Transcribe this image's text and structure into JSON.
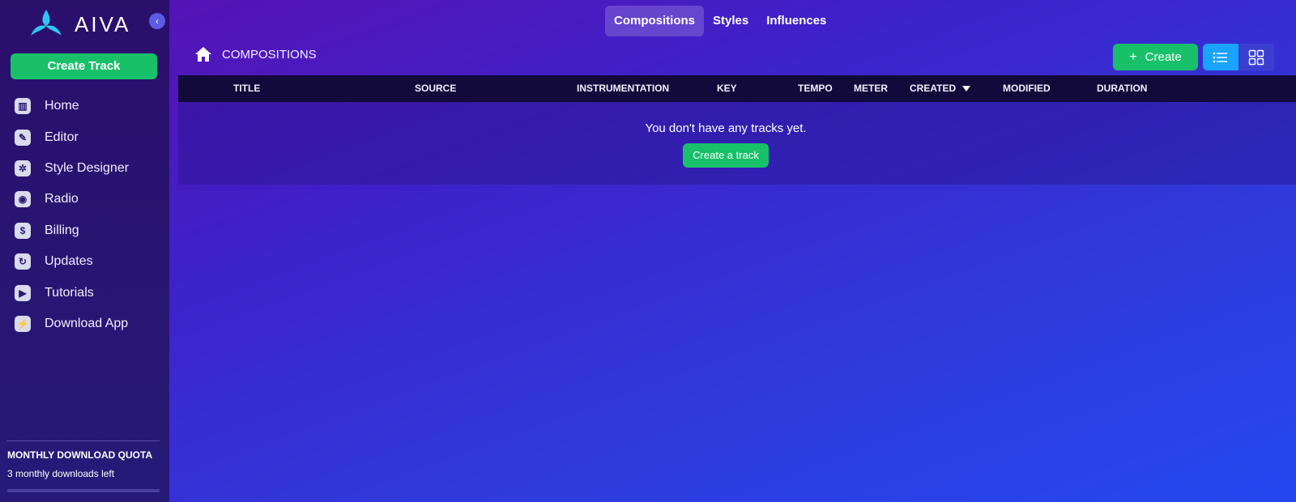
{
  "app": {
    "name": "AIVA"
  },
  "sidebar": {
    "create_track_label": "Create Track",
    "items": [
      {
        "label": "Home",
        "icon": "home-icon"
      },
      {
        "label": "Editor",
        "icon": "pencil-icon"
      },
      {
        "label": "Style Designer",
        "icon": "style-designer-icon"
      },
      {
        "label": "Radio",
        "icon": "radio-icon"
      },
      {
        "label": "Billing",
        "icon": "dollar-icon"
      },
      {
        "label": "Updates",
        "icon": "updates-icon"
      },
      {
        "label": "Tutorials",
        "icon": "play-icon"
      },
      {
        "label": "Download App",
        "icon": "download-icon"
      }
    ],
    "quota_title": "MONTHLY DOWNLOAD QUOTA",
    "quota_text": "3 monthly downloads left"
  },
  "tabs": [
    {
      "label": "Compositions",
      "active": true
    },
    {
      "label": "Styles",
      "active": false
    },
    {
      "label": "Influences",
      "active": false
    }
  ],
  "breadcrumb": {
    "label": "COMPOSITIONS"
  },
  "actions": {
    "create_label": "Create"
  },
  "table": {
    "headers": [
      "TITLE",
      "SOURCE",
      "INSTRUMENTATION",
      "KEY",
      "TEMPO",
      "METER",
      "CREATED",
      "MODIFIED",
      "DURATION"
    ],
    "empty_message": "You don't have any tracks yet.",
    "empty_cta": "Create a track"
  },
  "colors": {
    "accent_green": "#19c06a",
    "accent_blue": "#1aa3ff",
    "sidebar_bg": "#2a0f6b",
    "header_bg": "#120a3a"
  }
}
